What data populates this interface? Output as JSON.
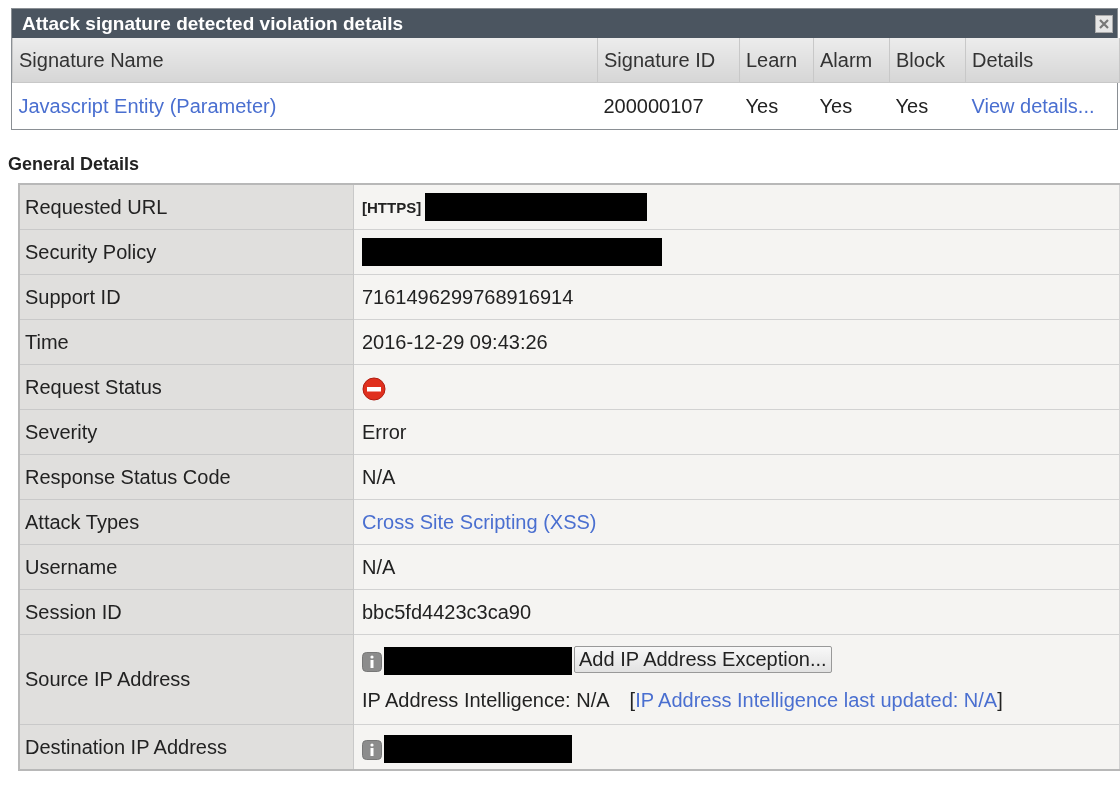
{
  "dialog": {
    "title": "Attack signature detected violation details",
    "columns": [
      "Signature Name",
      "Signature ID",
      "Learn",
      "Alarm",
      "Block",
      "Details"
    ],
    "rows": [
      {
        "name": "Javascript Entity (Parameter)",
        "signature_id": "200000107",
        "learn": "Yes",
        "alarm": "Yes",
        "block": "Yes",
        "details": "View details..."
      }
    ]
  },
  "general_details": {
    "heading": "General Details",
    "rows": [
      {
        "label": "Requested URL",
        "kind": "url",
        "tag": "[HTTPS]"
      },
      {
        "label": "Security Policy",
        "kind": "redacted"
      },
      {
        "label": "Support ID",
        "kind": "text",
        "value": "7161496299768916914"
      },
      {
        "label": "Time",
        "kind": "text",
        "value": "2016-12-29 09:43:26"
      },
      {
        "label": "Request Status",
        "kind": "status",
        "blocked": true
      },
      {
        "label": "Severity",
        "kind": "text",
        "value": "Error"
      },
      {
        "label": "Response Status Code",
        "kind": "text",
        "value": "N/A"
      },
      {
        "label": "Attack Types",
        "kind": "link",
        "value": "Cross Site Scripting (XSS)"
      },
      {
        "label": "Username",
        "kind": "text",
        "value": "N/A"
      },
      {
        "label": "Session ID",
        "kind": "text",
        "value": "bbc5fd4423c3ca90"
      },
      {
        "label": "Source IP Address",
        "kind": "ip",
        "button": "Add IP Address Exception...",
        "intelligence": "IP Address Intelligence: N/A",
        "link_prefix": "[",
        "link": "IP Address Intelligence last updated: N/A",
        "link_suffix": "]"
      },
      {
        "label": "Destination IP Address",
        "kind": "ip"
      }
    ]
  }
}
